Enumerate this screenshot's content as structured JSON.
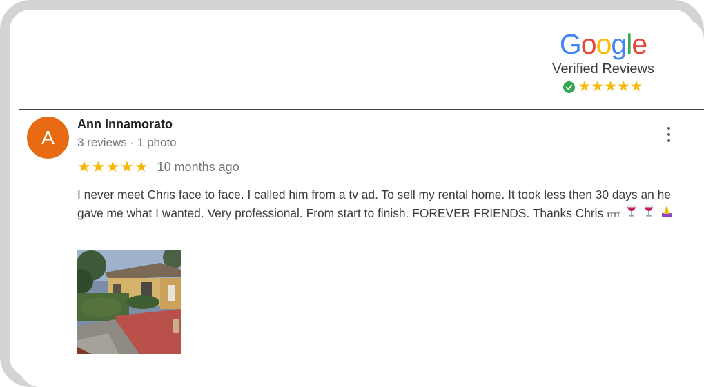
{
  "badge": {
    "logo_letters": [
      "G",
      "o",
      "o",
      "g",
      "l",
      "e"
    ],
    "subtitle": "Verified Reviews",
    "stars": "★★★★★",
    "colors": {
      "blue": "#4285F4",
      "red": "#EA4335",
      "yellow": "#FBBC05",
      "green": "#34A853"
    }
  },
  "review": {
    "avatar_initial": "A",
    "avatar_color": "#e86a13",
    "author": "Ann Innamorato",
    "meta": "3 reviews · 1 photo",
    "stars": "★★★★★",
    "rating": 5,
    "time_ago": "10 months ago",
    "body": "I never meet Chris face to face. I called him from a tv ad. To sell my rental home. It took less then 30 days an he gave me what I wanted. Very professional. From start to finish.  FOREVER FRIENDS. Thanks Chris",
    "body_suffix": "ɪᴛɪᴛ",
    "emojis": [
      "wine-glass-icon",
      "wine-glass-icon",
      "praying-hands-icon"
    ],
    "photo": "house-photo"
  }
}
